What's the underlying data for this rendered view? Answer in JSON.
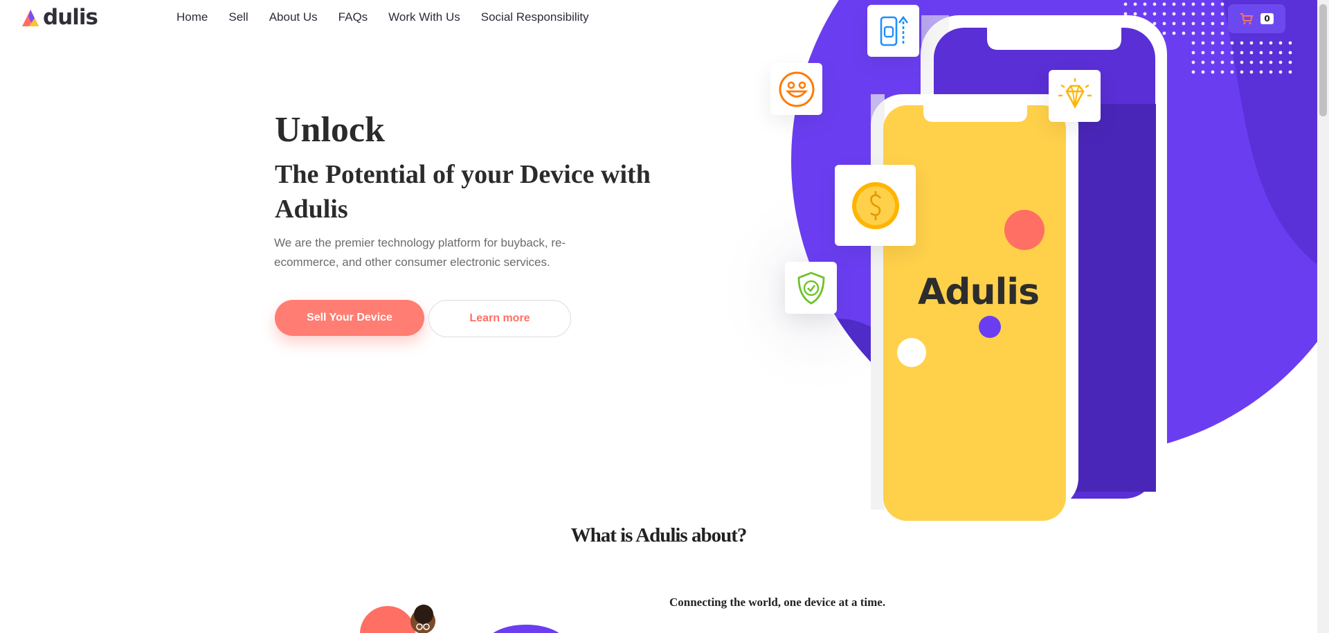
{
  "brand": {
    "name": "Adulis"
  },
  "nav": {
    "items": [
      {
        "label": "Home"
      },
      {
        "label": "Sell"
      },
      {
        "label": "About Us"
      },
      {
        "label": "FAQs"
      },
      {
        "label": "Work With Us"
      },
      {
        "label": "Social Responsibility"
      }
    ]
  },
  "cart": {
    "count": "0",
    "icon": "cart-icon"
  },
  "hero": {
    "title": "Unlock",
    "subtitle": "The Potential of your Device with Adulis",
    "lead": "We are the premier technology platform for buyback, re-ecommerce, and other consumer electronic services.",
    "primary_button": "Sell Your Device",
    "secondary_button": "Learn more",
    "phone_brand": "Adulis",
    "icons": [
      "phone-upload-icon",
      "smiley-icon",
      "diamond-icon",
      "dollar-coin-icon",
      "shield-check-icon"
    ]
  },
  "about": {
    "title": "What is Adulis about?",
    "tagline": "Connecting the world, one device at a time."
  },
  "colors": {
    "purple": "#6a3ef0",
    "coral": "#ff7d72",
    "yellow": "#ffd04a",
    "dark_purple": "#4a2bbd"
  }
}
